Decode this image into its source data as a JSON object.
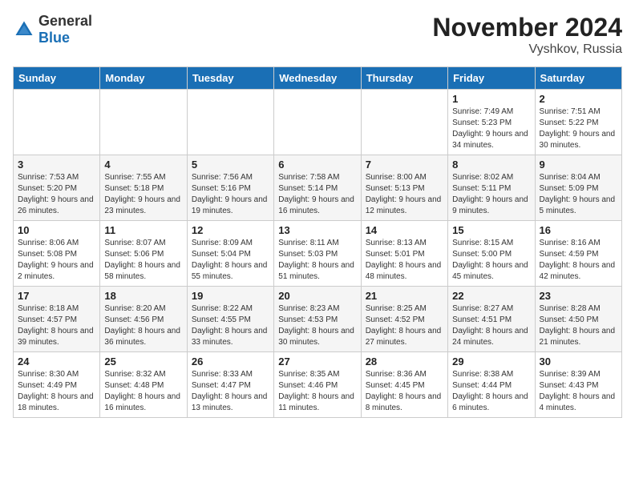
{
  "header": {
    "logo_general": "General",
    "logo_blue": "Blue",
    "month": "November 2024",
    "location": "Vyshkov, Russia"
  },
  "days_of_week": [
    "Sunday",
    "Monday",
    "Tuesday",
    "Wednesday",
    "Thursday",
    "Friday",
    "Saturday"
  ],
  "weeks": [
    [
      {
        "day": "",
        "info": ""
      },
      {
        "day": "",
        "info": ""
      },
      {
        "day": "",
        "info": ""
      },
      {
        "day": "",
        "info": ""
      },
      {
        "day": "",
        "info": ""
      },
      {
        "day": "1",
        "info": "Sunrise: 7:49 AM\nSunset: 5:23 PM\nDaylight: 9 hours and 34 minutes."
      },
      {
        "day": "2",
        "info": "Sunrise: 7:51 AM\nSunset: 5:22 PM\nDaylight: 9 hours and 30 minutes."
      }
    ],
    [
      {
        "day": "3",
        "info": "Sunrise: 7:53 AM\nSunset: 5:20 PM\nDaylight: 9 hours and 26 minutes."
      },
      {
        "day": "4",
        "info": "Sunrise: 7:55 AM\nSunset: 5:18 PM\nDaylight: 9 hours and 23 minutes."
      },
      {
        "day": "5",
        "info": "Sunrise: 7:56 AM\nSunset: 5:16 PM\nDaylight: 9 hours and 19 minutes."
      },
      {
        "day": "6",
        "info": "Sunrise: 7:58 AM\nSunset: 5:14 PM\nDaylight: 9 hours and 16 minutes."
      },
      {
        "day": "7",
        "info": "Sunrise: 8:00 AM\nSunset: 5:13 PM\nDaylight: 9 hours and 12 minutes."
      },
      {
        "day": "8",
        "info": "Sunrise: 8:02 AM\nSunset: 5:11 PM\nDaylight: 9 hours and 9 minutes."
      },
      {
        "day": "9",
        "info": "Sunrise: 8:04 AM\nSunset: 5:09 PM\nDaylight: 9 hours and 5 minutes."
      }
    ],
    [
      {
        "day": "10",
        "info": "Sunrise: 8:06 AM\nSunset: 5:08 PM\nDaylight: 9 hours and 2 minutes."
      },
      {
        "day": "11",
        "info": "Sunrise: 8:07 AM\nSunset: 5:06 PM\nDaylight: 8 hours and 58 minutes."
      },
      {
        "day": "12",
        "info": "Sunrise: 8:09 AM\nSunset: 5:04 PM\nDaylight: 8 hours and 55 minutes."
      },
      {
        "day": "13",
        "info": "Sunrise: 8:11 AM\nSunset: 5:03 PM\nDaylight: 8 hours and 51 minutes."
      },
      {
        "day": "14",
        "info": "Sunrise: 8:13 AM\nSunset: 5:01 PM\nDaylight: 8 hours and 48 minutes."
      },
      {
        "day": "15",
        "info": "Sunrise: 8:15 AM\nSunset: 5:00 PM\nDaylight: 8 hours and 45 minutes."
      },
      {
        "day": "16",
        "info": "Sunrise: 8:16 AM\nSunset: 4:59 PM\nDaylight: 8 hours and 42 minutes."
      }
    ],
    [
      {
        "day": "17",
        "info": "Sunrise: 8:18 AM\nSunset: 4:57 PM\nDaylight: 8 hours and 39 minutes."
      },
      {
        "day": "18",
        "info": "Sunrise: 8:20 AM\nSunset: 4:56 PM\nDaylight: 8 hours and 36 minutes."
      },
      {
        "day": "19",
        "info": "Sunrise: 8:22 AM\nSunset: 4:55 PM\nDaylight: 8 hours and 33 minutes."
      },
      {
        "day": "20",
        "info": "Sunrise: 8:23 AM\nSunset: 4:53 PM\nDaylight: 8 hours and 30 minutes."
      },
      {
        "day": "21",
        "info": "Sunrise: 8:25 AM\nSunset: 4:52 PM\nDaylight: 8 hours and 27 minutes."
      },
      {
        "day": "22",
        "info": "Sunrise: 8:27 AM\nSunset: 4:51 PM\nDaylight: 8 hours and 24 minutes."
      },
      {
        "day": "23",
        "info": "Sunrise: 8:28 AM\nSunset: 4:50 PM\nDaylight: 8 hours and 21 minutes."
      }
    ],
    [
      {
        "day": "24",
        "info": "Sunrise: 8:30 AM\nSunset: 4:49 PM\nDaylight: 8 hours and 18 minutes."
      },
      {
        "day": "25",
        "info": "Sunrise: 8:32 AM\nSunset: 4:48 PM\nDaylight: 8 hours and 16 minutes."
      },
      {
        "day": "26",
        "info": "Sunrise: 8:33 AM\nSunset: 4:47 PM\nDaylight: 8 hours and 13 minutes."
      },
      {
        "day": "27",
        "info": "Sunrise: 8:35 AM\nSunset: 4:46 PM\nDaylight: 8 hours and 11 minutes."
      },
      {
        "day": "28",
        "info": "Sunrise: 8:36 AM\nSunset: 4:45 PM\nDaylight: 8 hours and 8 minutes."
      },
      {
        "day": "29",
        "info": "Sunrise: 8:38 AM\nSunset: 4:44 PM\nDaylight: 8 hours and 6 minutes."
      },
      {
        "day": "30",
        "info": "Sunrise: 8:39 AM\nSunset: 4:43 PM\nDaylight: 8 hours and 4 minutes."
      }
    ]
  ]
}
